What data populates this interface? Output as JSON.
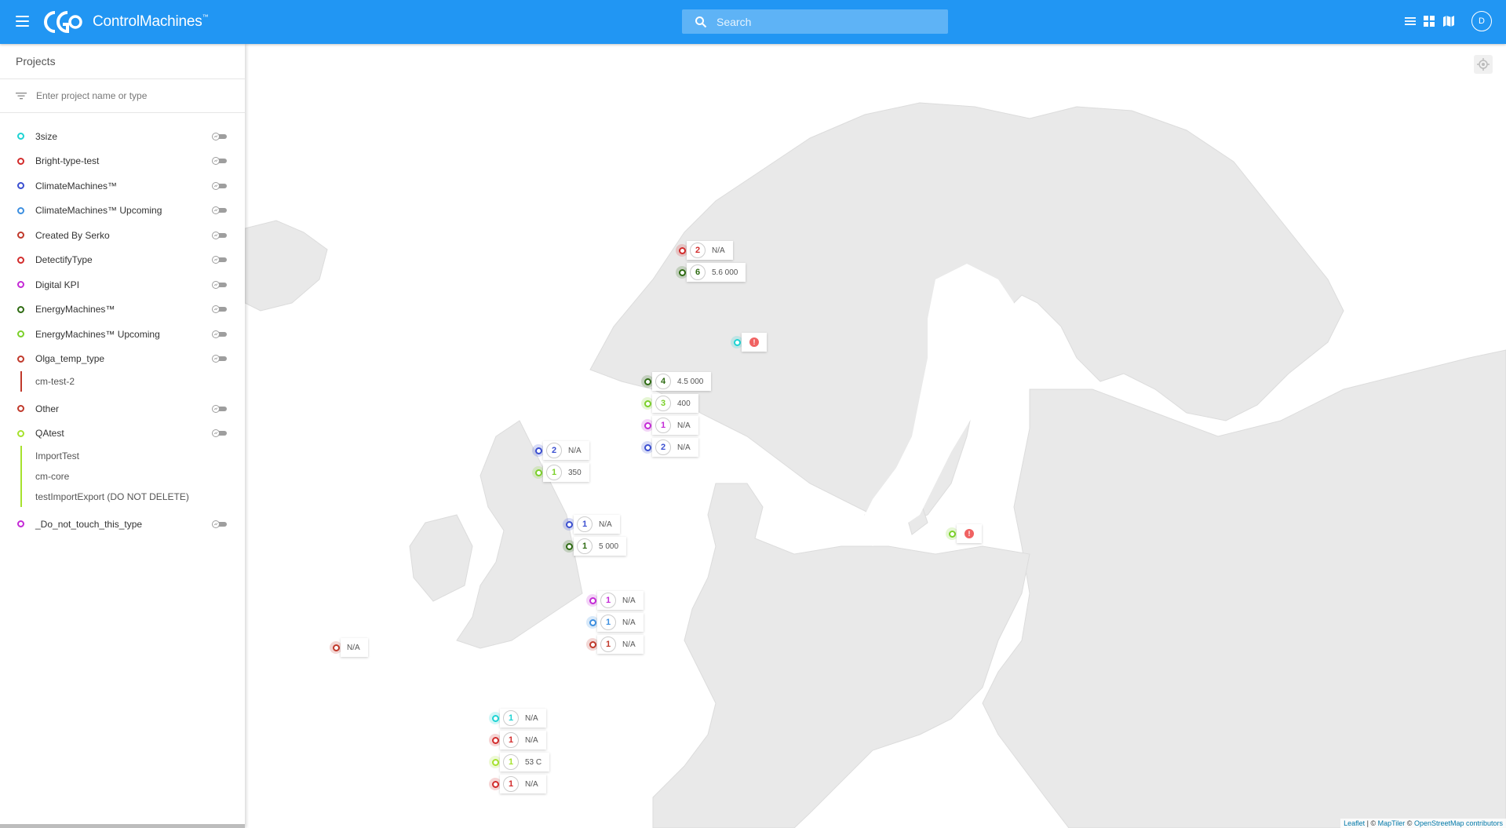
{
  "header": {
    "brand": "ControlMachines",
    "brand_mark": "™",
    "search_placeholder": "Search",
    "avatar_initial": "D"
  },
  "sidebar": {
    "title": "Projects",
    "filter_placeholder": "Enter project name or type",
    "projects": [
      {
        "name": "3size",
        "color": "#1dd3d3"
      },
      {
        "name": "Bright-type-test",
        "color": "#d22b2b"
      },
      {
        "name": "ClimateMachines™",
        "color": "#3b4fd1"
      },
      {
        "name": "ClimateMachines™ Upcoming",
        "color": "#3d8fe0"
      },
      {
        "name": "Created By Serko",
        "color": "#c0392b"
      },
      {
        "name": "DetectifyType",
        "color": "#d22b2b"
      },
      {
        "name": "Digital KPI",
        "color": "#c42ad6"
      },
      {
        "name": "EnergyMachines™",
        "color": "#2e6b12"
      },
      {
        "name": "EnergyMachines™ Upcoming",
        "color": "#7bd02a"
      },
      {
        "name": "Olga_temp_type",
        "color": "#c0392b",
        "children": [
          "cm-test-2"
        ]
      },
      {
        "name": "Other",
        "color": "#c0392b"
      },
      {
        "name": "QAtest",
        "color": "#a6e22e",
        "children": [
          "ImportTest",
          "cm-core",
          "testImportExport (DO NOT DELETE)"
        ]
      },
      {
        "name": "_Do_not_touch_this_type",
        "color": "#c42ad6"
      }
    ]
  },
  "map": {
    "attribution": {
      "leaflet": "Leaflet",
      "sep1": " | © ",
      "maptiler": "MapTiler",
      "sep2": " © ",
      "osm": "OpenStreetMap contributors"
    },
    "markers": [
      {
        "color": "#d22b2b",
        "count": "2",
        "value": "N/A"
      },
      {
        "color": "#2e6b12",
        "count": "6",
        "value": "5.6 000"
      },
      {
        "color": "#1dd3d3",
        "count": "",
        "value": "!"
      },
      {
        "color": "#2e6b12",
        "count": "4",
        "value": "4.5 000"
      },
      {
        "color": "#7bd02a",
        "count": "3",
        "value": "400"
      },
      {
        "color": "#c42ad6",
        "count": "1",
        "value": "N/A"
      },
      {
        "color": "#3b4fd1",
        "count": "2",
        "value": "N/A"
      },
      {
        "color": "#3b4fd1",
        "count": "2",
        "value": "N/A"
      },
      {
        "color": "#7bd02a",
        "count": "1",
        "value": "350"
      },
      {
        "color": "#3b4fd1",
        "count": "1",
        "value": "N/A"
      },
      {
        "color": "#2e6b12",
        "count": "1",
        "value": "5 000"
      },
      {
        "color": "#7bd02a",
        "count": "",
        "value": "!"
      },
      {
        "color": "#c42ad6",
        "count": "1",
        "value": "N/A"
      },
      {
        "color": "#3d8fe0",
        "count": "1",
        "value": "N/A"
      },
      {
        "color": "#c0392b",
        "count": "1",
        "value": "N/A"
      },
      {
        "color": "#c0392b",
        "count": "",
        "value": "N/A"
      },
      {
        "color": "#1dd3d3",
        "count": "1",
        "value": "N/A"
      },
      {
        "color": "#d22b2b",
        "count": "1",
        "value": "N/A"
      },
      {
        "color": "#a6e22e",
        "count": "1",
        "value": "53 C"
      },
      {
        "color": "#d22b2b",
        "count": "1",
        "value": "N/A"
      }
    ]
  }
}
